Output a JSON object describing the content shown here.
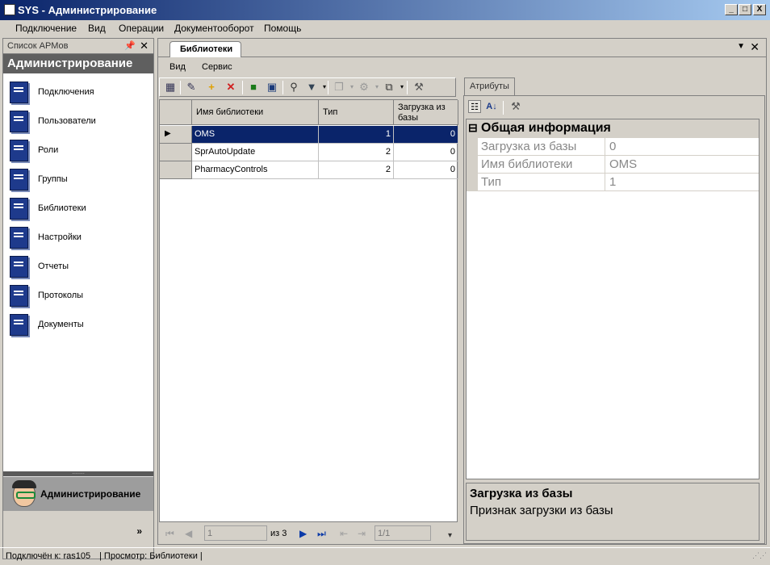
{
  "window": {
    "title": "SYS - Администрирование",
    "controls": {
      "minimize": "_",
      "maximize": "□",
      "close": "X"
    }
  },
  "menubar": [
    "Подключение",
    "Вид",
    "Операции",
    "Документооборот",
    "Помощь"
  ],
  "leftpanel": {
    "header": "Список АРМов",
    "title": "Администрирование",
    "items": [
      {
        "label": "Подключения"
      },
      {
        "label": "Пользователи"
      },
      {
        "label": "Роли"
      },
      {
        "label": "Группы"
      },
      {
        "label": "Библиотеки"
      },
      {
        "label": "Настройки"
      },
      {
        "label": "Отчеты"
      },
      {
        "label": "Протоколы"
      },
      {
        "label": "Документы"
      }
    ],
    "active_group": "Администрирование"
  },
  "document": {
    "tab": "Библиотеки",
    "menu": [
      "Вид",
      "Сервис"
    ],
    "grid": {
      "columns": [
        "Имя библиотеки",
        "Тип",
        "Загрузка из базы"
      ],
      "rows": [
        {
          "name": "OMS",
          "type": "1",
          "load": "0",
          "selected": true
        },
        {
          "name": "SprAutoUpdate",
          "type": "2",
          "load": "0",
          "selected": false
        },
        {
          "name": "PharmacyControls",
          "type": "2",
          "load": "0",
          "selected": false
        }
      ]
    },
    "navigator": {
      "position": "1",
      "of_label": "из 3",
      "page": "1/1"
    }
  },
  "properties": {
    "tab": "Атрибуты",
    "category": "Общая информация",
    "rows": [
      {
        "key": "Загрузка из базы",
        "value": "0"
      },
      {
        "key": "Имя библиотеки",
        "value": "OMS"
      },
      {
        "key": "Тип",
        "value": "1"
      }
    ],
    "description": {
      "title": "Загрузка из базы",
      "text": "Признак загрузки из базы"
    }
  },
  "statusbar": {
    "connected": "Подключён к: ras105",
    "view": "| Просмотр: Библиотеки |"
  }
}
